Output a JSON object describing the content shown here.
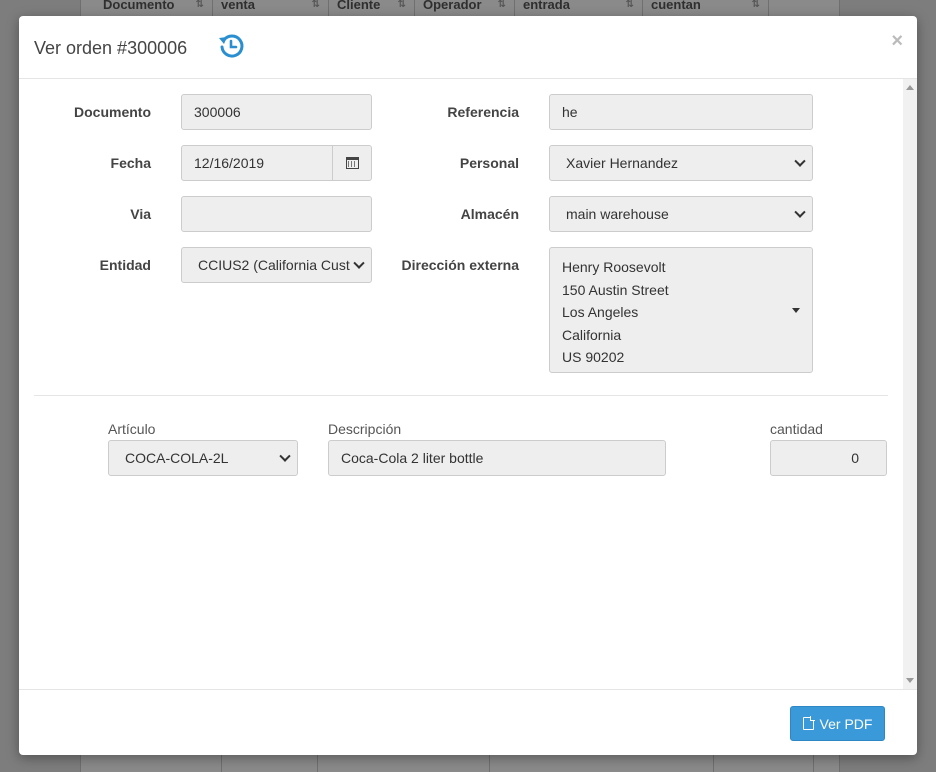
{
  "background": {
    "columns": [
      {
        "label": "Documento"
      },
      {
        "label": "venta"
      },
      {
        "label": "Cliente"
      },
      {
        "label": "Operador"
      },
      {
        "label": "entrada"
      },
      {
        "label": "cuentan"
      }
    ]
  },
  "modal": {
    "title": "Ver orden #300006",
    "close_label": "×",
    "form": {
      "documento": {
        "label": "Documento",
        "value": "300006"
      },
      "referencia": {
        "label": "Referencia",
        "value": "he"
      },
      "fecha": {
        "label": "Fecha",
        "value": "12/16/2019"
      },
      "personal": {
        "label": "Personal",
        "value": "Xavier Hernandez"
      },
      "via": {
        "label": "Via",
        "value": ""
      },
      "almacen": {
        "label": "Almacén",
        "value": "main warehouse"
      },
      "entidad": {
        "label": "Entidad",
        "value": "CCIUS2 (California Cust"
      },
      "direccion": {
        "label": "Dirección externa",
        "lines": [
          "Henry Roosevolt",
          "150 Austin Street",
          "Los Angeles",
          "California",
          "US 90202"
        ]
      }
    },
    "items": {
      "headers": {
        "articulo": "Artículo",
        "descripcion": "Descripción",
        "cantidad": "cantidad"
      },
      "row": {
        "articulo": "COCA-COLA-2L",
        "descripcion": "Coca-Cola 2 liter bottle",
        "cantidad": "0"
      }
    },
    "footer": {
      "pdf_button": "Ver PDF"
    }
  },
  "colors": {
    "primary": "#3a9ad9",
    "history_icon": "#2a8fd0",
    "input_bg": "#eeeeee"
  }
}
